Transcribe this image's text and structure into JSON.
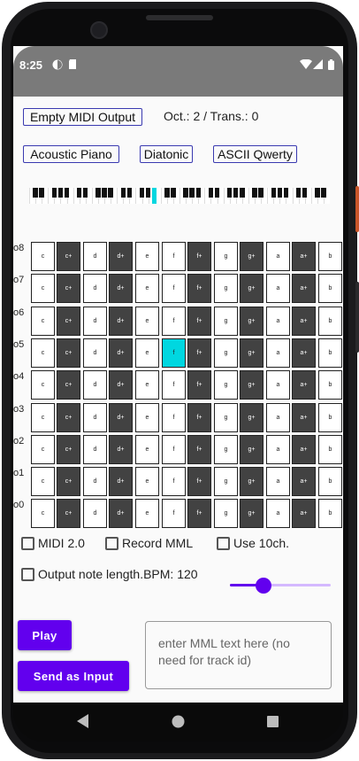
{
  "status_bar": {
    "time": "8:25"
  },
  "toolbar": {
    "output_button": "Empty MIDI Output",
    "octave_transpose": "Oct.: 2 / Trans.: 0",
    "instrument_button": "Acoustic Piano",
    "scale_button": "Diatonic",
    "layout_button": "ASCII Qwerty"
  },
  "mini_keyboard": {
    "active_key_index": 14,
    "white_key_count": 48
  },
  "keyboard_grid": {
    "octave_labels": [
      "o8",
      "o7",
      "o6",
      "o5",
      "o4",
      "o3",
      "o2",
      "o1",
      "o0"
    ],
    "notes": [
      "c",
      "c+",
      "d",
      "d+",
      "e",
      "f",
      "f+",
      "g",
      "g+",
      "a",
      "a+",
      "b"
    ],
    "active": {
      "octave": "o5",
      "note": "f"
    }
  },
  "options": {
    "midi2": "MIDI 2.0",
    "record_mml": "Record MML",
    "use_10ch": "Use 10ch.",
    "output_note_length": "Output note length.",
    "bpm_label": "BPM: 120",
    "bpm_slider_fraction": 0.33
  },
  "actions": {
    "play": "Play",
    "send_as_input": "Send as Input",
    "mml_placeholder": "enter MML text here (no need for track id)"
  },
  "colors": {
    "accent": "#6200ee",
    "active_key": "#00d7e0",
    "black_key": "#424242"
  }
}
